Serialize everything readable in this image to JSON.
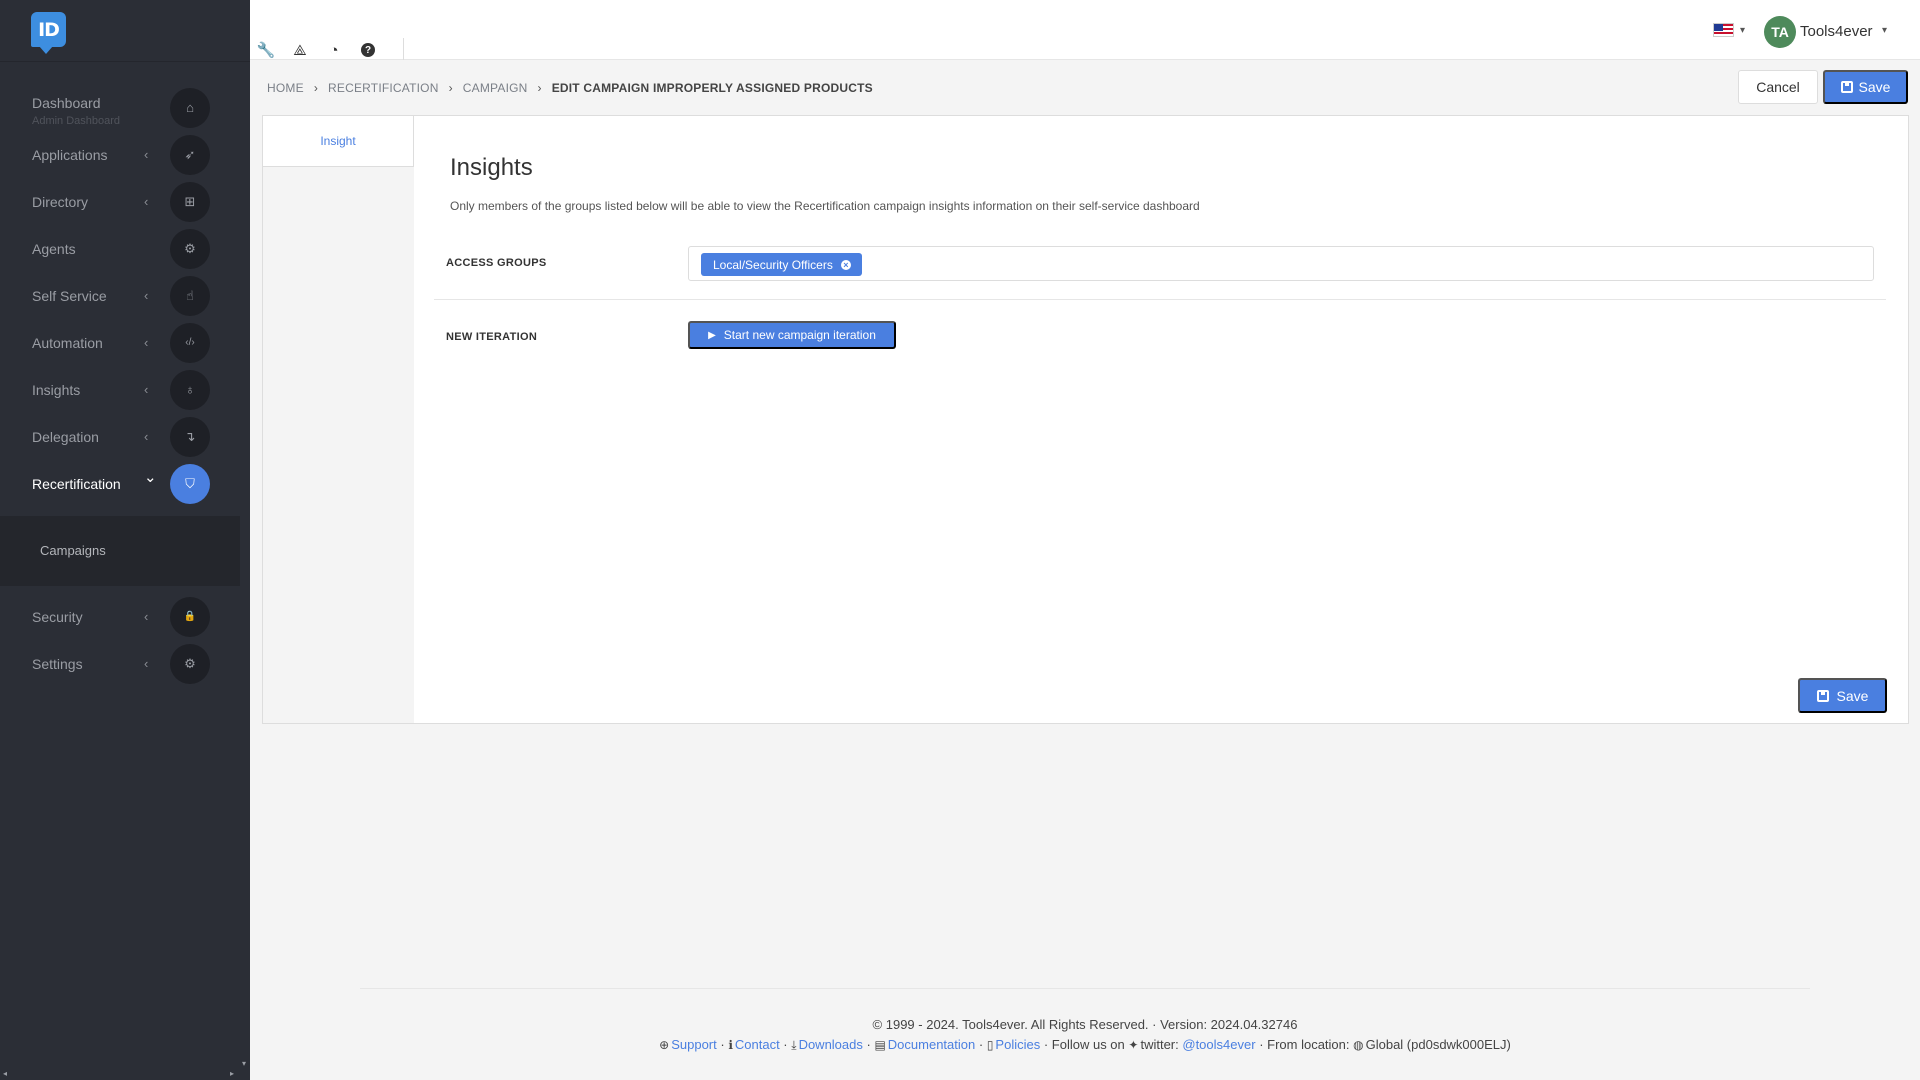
{
  "app": {
    "logo_text": "ID"
  },
  "sidebar": {
    "items": [
      {
        "label": "Dashboard",
        "sub": "Admin Dashboard",
        "chevron": "",
        "icon": "home-icon",
        "glyph": "⌂"
      },
      {
        "label": "Applications",
        "chevron": "‹",
        "icon": "rocket-icon",
        "glyph": "➶"
      },
      {
        "label": "Directory",
        "chevron": "‹",
        "icon": "sitemap-icon",
        "glyph": "⊞"
      },
      {
        "label": "Agents",
        "chevron": "",
        "icon": "cubes-icon",
        "glyph": "⚙"
      },
      {
        "label": "Self Service",
        "chevron": "‹",
        "icon": "hand-pointer-icon",
        "glyph": "☝"
      },
      {
        "label": "Automation",
        "chevron": "‹",
        "icon": "code-icon",
        "glyph": "‹/›"
      },
      {
        "label": "Insights",
        "chevron": "‹",
        "icon": "lightbulb-icon",
        "glyph": "♁"
      },
      {
        "label": "Delegation",
        "chevron": "‹",
        "icon": "level-down-icon",
        "glyph": "↴"
      },
      {
        "label": "Recertification",
        "chevron": "⌄",
        "icon": "shield-icon",
        "glyph": "⛉"
      },
      {
        "label": "Security",
        "chevron": "‹",
        "icon": "lock-icon",
        "glyph": "🔒"
      },
      {
        "label": "Settings",
        "chevron": "‹",
        "icon": "gear-icon",
        "glyph": "⚙"
      }
    ],
    "submenu": {
      "label": "Campaigns"
    }
  },
  "toolbar": {
    "icons": [
      {
        "name": "wrench-icon",
        "glyph": "🔧"
      },
      {
        "name": "vector-icon",
        "glyph": "⟁"
      },
      {
        "name": "pie-chart-icon",
        "glyph": "◔"
      },
      {
        "name": "help-icon",
        "glyph": "?"
      }
    ]
  },
  "user": {
    "initials": "TA",
    "name": "Tools4ever"
  },
  "breadcrumb": {
    "items": [
      "HOME",
      "RECERTIFICATION",
      "CAMPAIGN"
    ],
    "current": "EDIT CAMPAIGN IMPROPERLY ASSIGNED PRODUCTS"
  },
  "actions": {
    "cancel": "Cancel",
    "save": "Save"
  },
  "panel": {
    "tab": "Insight",
    "title": "Insights",
    "description": "Only members of the groups listed below will be able to view the Recertification campaign insights information on their self-service dashboard",
    "access_groups_label": "ACCESS GROUPS",
    "access_groups": [
      "Local/Security Officers"
    ],
    "new_iteration_label": "NEW ITERATION",
    "start_iteration_button": "Start new campaign iteration",
    "save": "Save"
  },
  "footer": {
    "copyright": "© 1999 - 2024. Tools4ever. All Rights Reserved. · Version: 2024.04.32746",
    "support": "Support",
    "contact": "Contact",
    "downloads": "Downloads",
    "documentation": "Documentation",
    "policies": "Policies",
    "follow": "· Follow us on",
    "twitter_label": "twitter:",
    "twitter_handle": "@tools4ever",
    "from_location": "· From location:",
    "location": "Global (pd0sdwk000ELJ)"
  },
  "colors": {
    "accent": "#4a7fe0",
    "sidebar_bg": "#2b2e36",
    "avatar": "#4e8a5b"
  }
}
